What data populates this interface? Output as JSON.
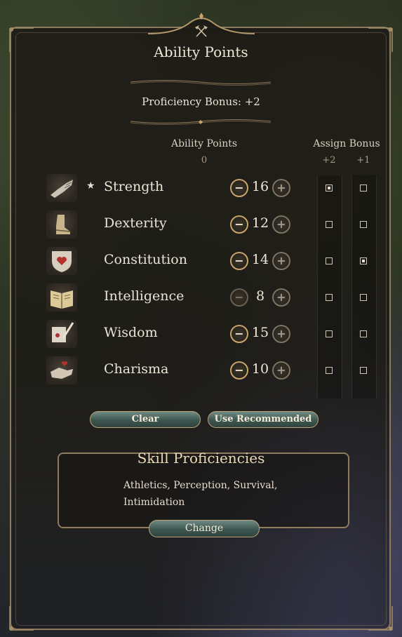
{
  "panel": {
    "title": "Ability Points",
    "proficiency_bonus": "Proficiency Bonus: +2",
    "header_icon": "crossed-axes-icon"
  },
  "columns": {
    "ability_points_label": "Ability Points",
    "ability_points_remaining": "0",
    "assign_bonus_label": "Assign Bonus",
    "bonus_plus2": "+2",
    "bonus_plus1": "+1"
  },
  "abilities": [
    {
      "name": "Strength",
      "score": "16",
      "starred": true,
      "icon": "gauntlet-icon",
      "bonus2": true,
      "bonus1": false,
      "minus_enabled": true
    },
    {
      "name": "Dexterity",
      "score": "12",
      "starred": false,
      "icon": "boot-icon",
      "bonus2": false,
      "bonus1": false,
      "minus_enabled": true
    },
    {
      "name": "Constitution",
      "score": "14",
      "starred": false,
      "icon": "heart-shield-icon",
      "bonus2": false,
      "bonus1": true,
      "minus_enabled": true
    },
    {
      "name": "Intelligence",
      "score": "8",
      "starred": false,
      "icon": "book-icon",
      "bonus2": false,
      "bonus1": false,
      "minus_enabled": false
    },
    {
      "name": "Wisdom",
      "score": "15",
      "starred": false,
      "icon": "scroll-quill-icon",
      "bonus2": false,
      "bonus1": false,
      "minus_enabled": true
    },
    {
      "name": "Charisma",
      "score": "10",
      "starred": false,
      "icon": "hand-heart-icon",
      "bonus2": false,
      "bonus1": false,
      "minus_enabled": true
    }
  ],
  "buttons": {
    "clear": "Clear",
    "use_recommended": "Use Recommended",
    "minus_symbol": "−",
    "plus_symbol": "+"
  },
  "skills": {
    "title": "Skill Proficiencies",
    "list": "Athletics, Perception, Survival, Intimidation",
    "change": "Change"
  },
  "colors": {
    "gold_border": "#c9a46a",
    "button_teal": "#3e5650",
    "text_light": "#ebe3d5"
  }
}
